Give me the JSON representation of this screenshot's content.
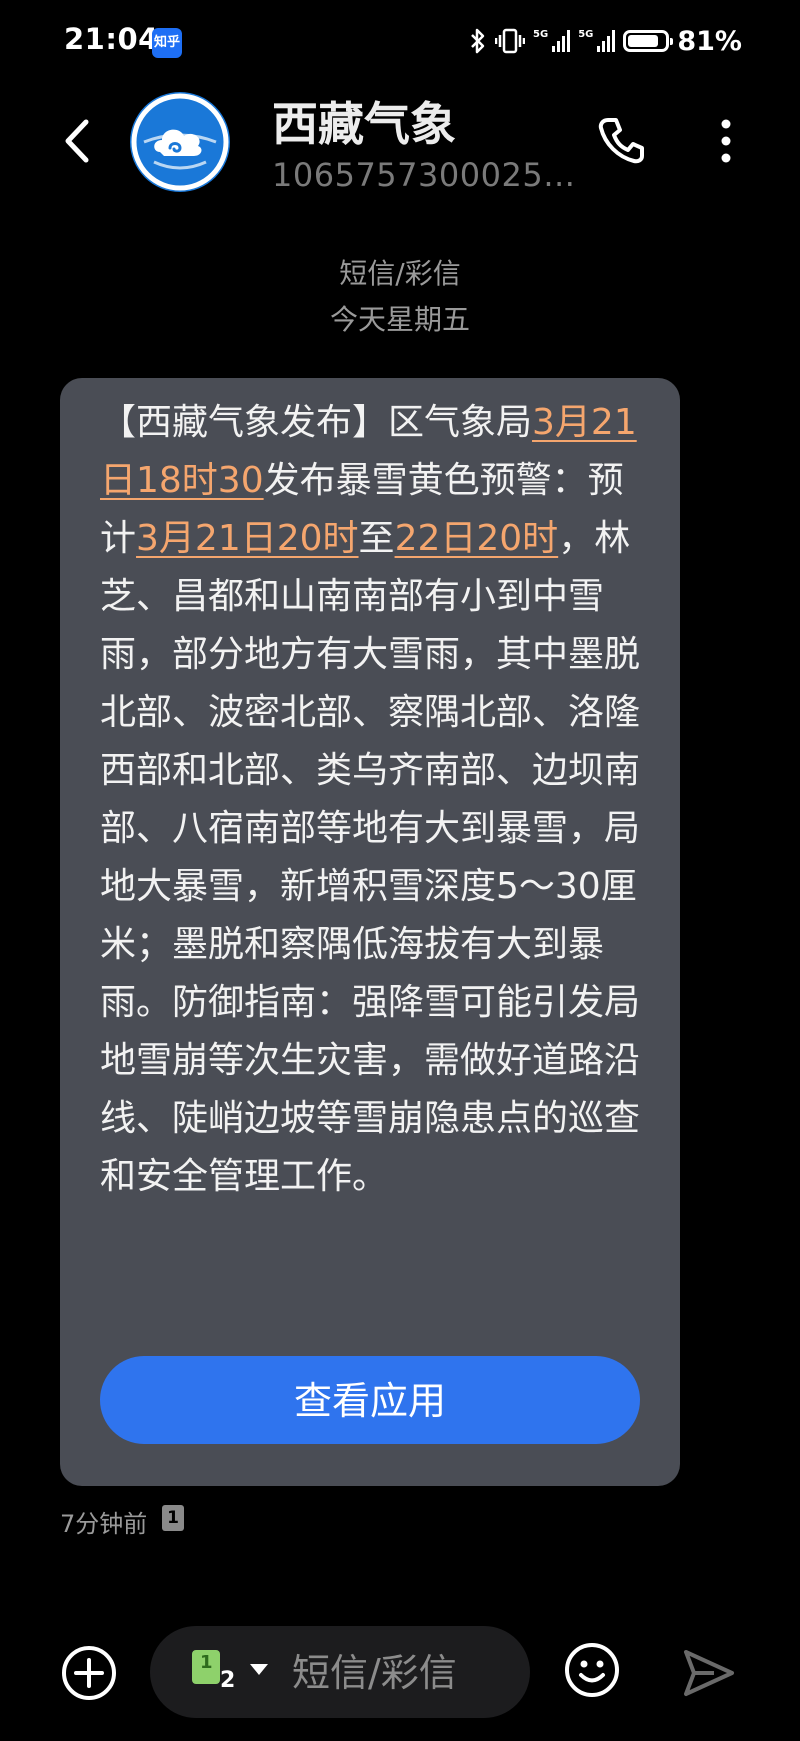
{
  "status_bar": {
    "time": "21:04",
    "app_badge": "知乎",
    "signal1_label": "5G",
    "signal2_label": "5G",
    "battery_percent": 81,
    "battery_text": "81%"
  },
  "header": {
    "contact_name": "西藏气象",
    "contact_number": "1065757300025…",
    "avatar_color": "#1a78d8"
  },
  "meta": {
    "message_type": "短信/彩信",
    "day": "今天星期五"
  },
  "message": {
    "segments": [
      {
        "text": "【西藏气象发布】区气象局",
        "link": false
      },
      {
        "text": "3月21日18时30",
        "link": true
      },
      {
        "text": "发布暴雪黄色预警：预计",
        "link": false
      },
      {
        "text": "3月21日20时",
        "link": true
      },
      {
        "text": "至",
        "link": false
      },
      {
        "text": "22日20时",
        "link": true
      },
      {
        "text": "，林芝、昌都和山南南部有小到中雪雨，部分地方有大雪雨，其中墨脱北部、波密北部、察隅北部、洛隆西部和北部、类乌齐南部、边坝南部、八宿南部等地有大到暴雪，局地大暴雪，新增积雪深度5～30厘米；墨脱和察隅低海拔有大到暴雨。防御指南：强降雪可能引发局地雪崩等次生灾害，需做好道路沿线、陡峭边坡等雪崩隐患点的巡查和安全管理工作。",
        "link": false
      }
    ],
    "action_button": "查看应用",
    "timestamp": "7分钟前",
    "sim_indicator": "1"
  },
  "composer": {
    "sim_number_a": "1",
    "sim_number_b": "2",
    "placeholder": "短信/彩信"
  },
  "colors": {
    "background": "#000000",
    "bubble": "#4a4d55",
    "link": "#f5a66e",
    "button": "#2f74ee"
  },
  "icons": [
    "back-arrow-icon",
    "phone-icon",
    "more-vertical-icon",
    "add-circle-icon",
    "emoji-icon",
    "send-icon",
    "bluetooth-icon",
    "vibrate-icon",
    "battery-icon"
  ]
}
